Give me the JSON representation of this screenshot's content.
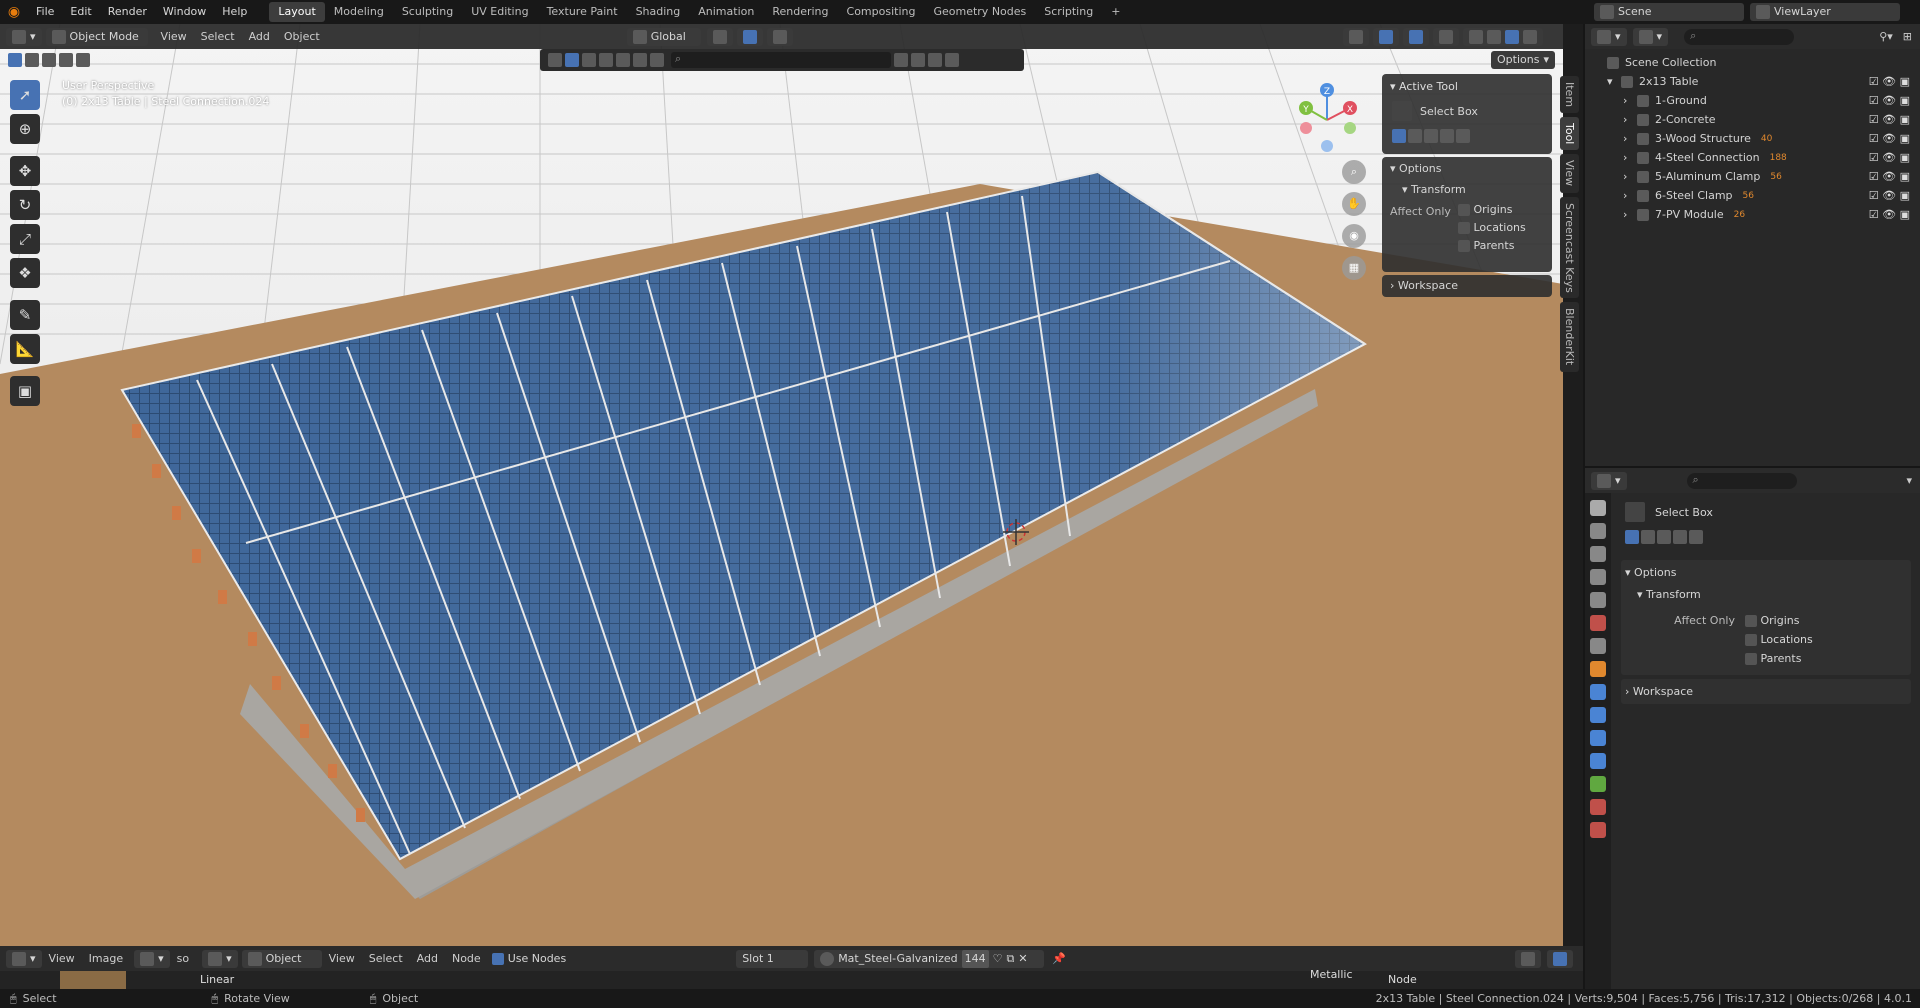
{
  "topbar": {
    "menus": [
      "File",
      "Edit",
      "Render",
      "Window",
      "Help"
    ],
    "workspaces": [
      "Layout",
      "Modeling",
      "Sculpting",
      "UV Editing",
      "Texture Paint",
      "Shading",
      "Animation",
      "Rendering",
      "Compositing",
      "Geometry Nodes",
      "Scripting"
    ],
    "active_workspace": "Layout",
    "add_tab": "+",
    "scene": "Scene",
    "view_layer": "ViewLayer"
  },
  "viewport": {
    "mode": "Object Mode",
    "menus": [
      "View",
      "Select",
      "Add",
      "Object"
    ],
    "transform_orientation": "Global",
    "options_label": "Options",
    "overlay_line1": "User Perspective",
    "overlay_line2": "(0) 2x13 Table | Steel Connection.024",
    "side_tabs": [
      "Item",
      "Tool",
      "View",
      "Screencast Keys",
      "BlenderKit"
    ],
    "gizmo": {
      "x": "X",
      "y": "Y",
      "z": "Z"
    }
  },
  "tool_panel": {
    "active_tool_header": "Active Tool",
    "tool_name": "Select Box",
    "options_header": "Options",
    "transform_header": "Transform",
    "affect_only": "Affect Only",
    "checks": [
      "Origins",
      "Locations",
      "Parents"
    ],
    "workspace_header": "Workspace"
  },
  "outliner": {
    "root": "Scene Collection",
    "collection": "2x13 Table",
    "items": [
      {
        "label": "1-Ground",
        "badge": ""
      },
      {
        "label": "2-Concrete",
        "badge": ""
      },
      {
        "label": "3-Wood Structure",
        "badge": "40"
      },
      {
        "label": "4-Steel Connection",
        "badge": "188"
      },
      {
        "label": "5-Aluminum Clamp",
        "badge": "56"
      },
      {
        "label": "6-Steel Clamp",
        "badge": "56"
      },
      {
        "label": "7-PV Module",
        "badge": "26"
      }
    ]
  },
  "properties": {
    "tool_name": "Select Box",
    "options_header": "Options",
    "transform_header": "Transform",
    "affect_only": "Affect Only",
    "checks": [
      "Origins",
      "Locations",
      "Parents"
    ],
    "workspace_header": "Workspace"
  },
  "shader_header": {
    "menus_left": [
      "View",
      "Image"
    ],
    "so": "so",
    "object_type": "Object",
    "menus": [
      "View",
      "Select",
      "Add",
      "Node"
    ],
    "use_nodes": "Use Nodes",
    "slot": "Slot 1",
    "material": "Mat_Steel-Galvanized",
    "users": "144",
    "linear": "Linear",
    "metallic": "Metallic",
    "node": "Node"
  },
  "statusbar": {
    "select": "Select",
    "rotate": "Rotate View",
    "object": "Object",
    "info": "2x13 Table | Steel Connection.024 | Verts:9,504 | Faces:5,756 | Tris:17,312 | Objects:0/268 | 4.0.1"
  },
  "colors": {
    "accent": "#4772b3",
    "ground": "#b48a5f",
    "panel_blue": "#2f4d7a",
    "outliner_icon": "#e0882e"
  }
}
